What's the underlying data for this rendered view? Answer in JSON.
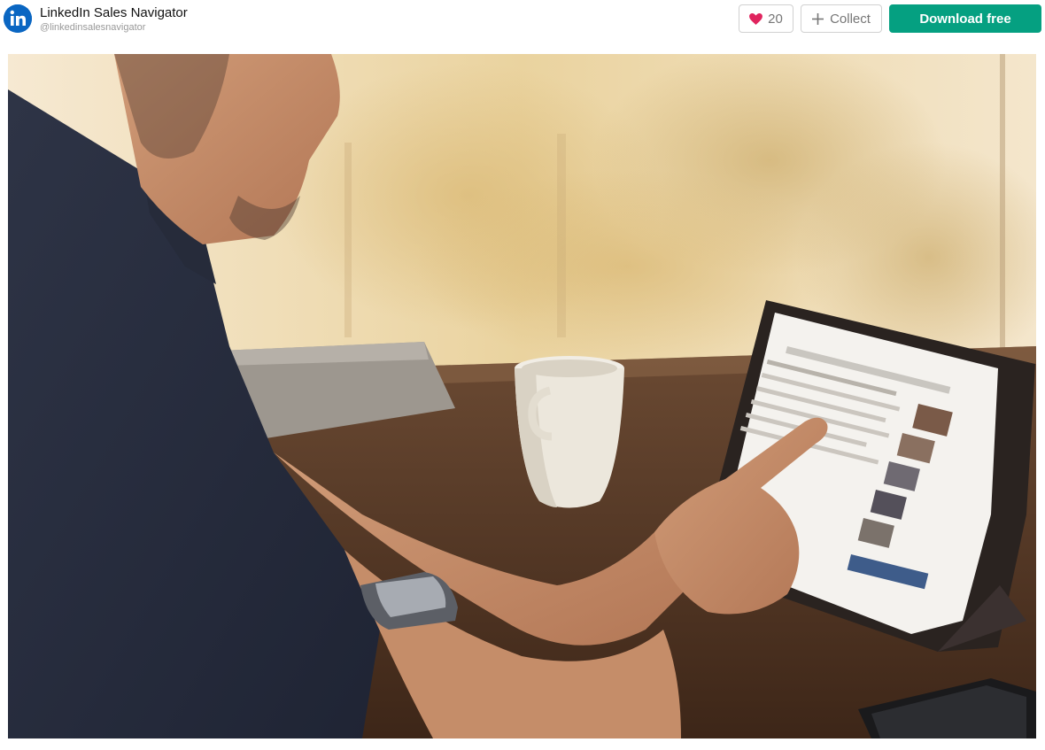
{
  "author": {
    "name": "LinkedIn Sales Navigator",
    "handle": "@linkedinsalesnavigator",
    "avatar_icon": "linkedin-logo-icon",
    "avatar_color": "#0a66c2"
  },
  "actions": {
    "like_count": "20",
    "like_icon": "heart-icon",
    "like_color": "#e0245e",
    "collect_label": "Collect",
    "collect_icon": "plus-icon",
    "download_label": "Download free",
    "download_color": "#05a081"
  },
  "photo": {
    "subject": "man using tablet at table with coffee cup"
  }
}
